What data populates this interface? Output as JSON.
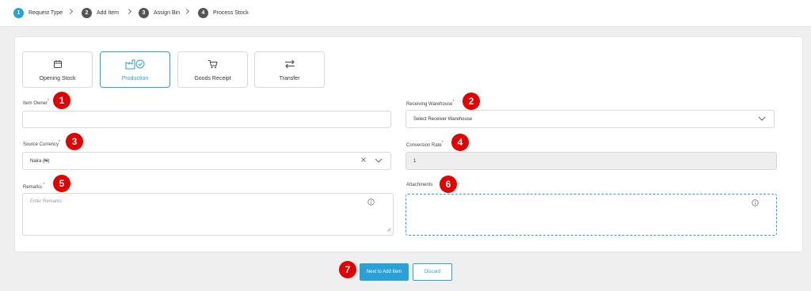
{
  "stepper": {
    "steps": [
      {
        "num": "1",
        "label": "Request Type"
      },
      {
        "num": "2",
        "label": "Add Item"
      },
      {
        "num": "3",
        "label": "Assign Bin"
      },
      {
        "num": "4",
        "label": "Process Stock"
      }
    ]
  },
  "request_types": [
    {
      "label": "Opening Stock",
      "icon": "calendar-box-icon"
    },
    {
      "label": "Production",
      "icon": "factory-check-icon",
      "selected": true
    },
    {
      "label": "Goods Receipt",
      "icon": "cart-icon"
    },
    {
      "label": "Transfer",
      "icon": "transfer-arrows-icon"
    }
  ],
  "form": {
    "item_owner": {
      "label": "Item Owner",
      "required_mark": "*",
      "value": ""
    },
    "receiving_warehouse": {
      "label": "Receiving Warehouse",
      "required_mark": "*",
      "placeholder": "Select Receiver Warehouse"
    },
    "source_currency": {
      "label": "Source Currency",
      "required_mark": "*",
      "value": "Naira (₦)"
    },
    "conversion_rate": {
      "label": "Conversion Rate",
      "required_mark": "*",
      "value": "1"
    },
    "remarks": {
      "label": "Remarks ",
      "required_mark": "*",
      "placeholder": "Enter Remarks"
    },
    "attachments": {
      "label": "Attachments"
    }
  },
  "markers": [
    "1",
    "2",
    "3",
    "4",
    "5",
    "6",
    "7"
  ],
  "actions": {
    "next_label": "Next to Add Item",
    "discard_label": "Discard"
  },
  "colors": {
    "accent": "#2aa0d8",
    "marker": "#e30000",
    "disabled_bg": "#eeeeee"
  }
}
